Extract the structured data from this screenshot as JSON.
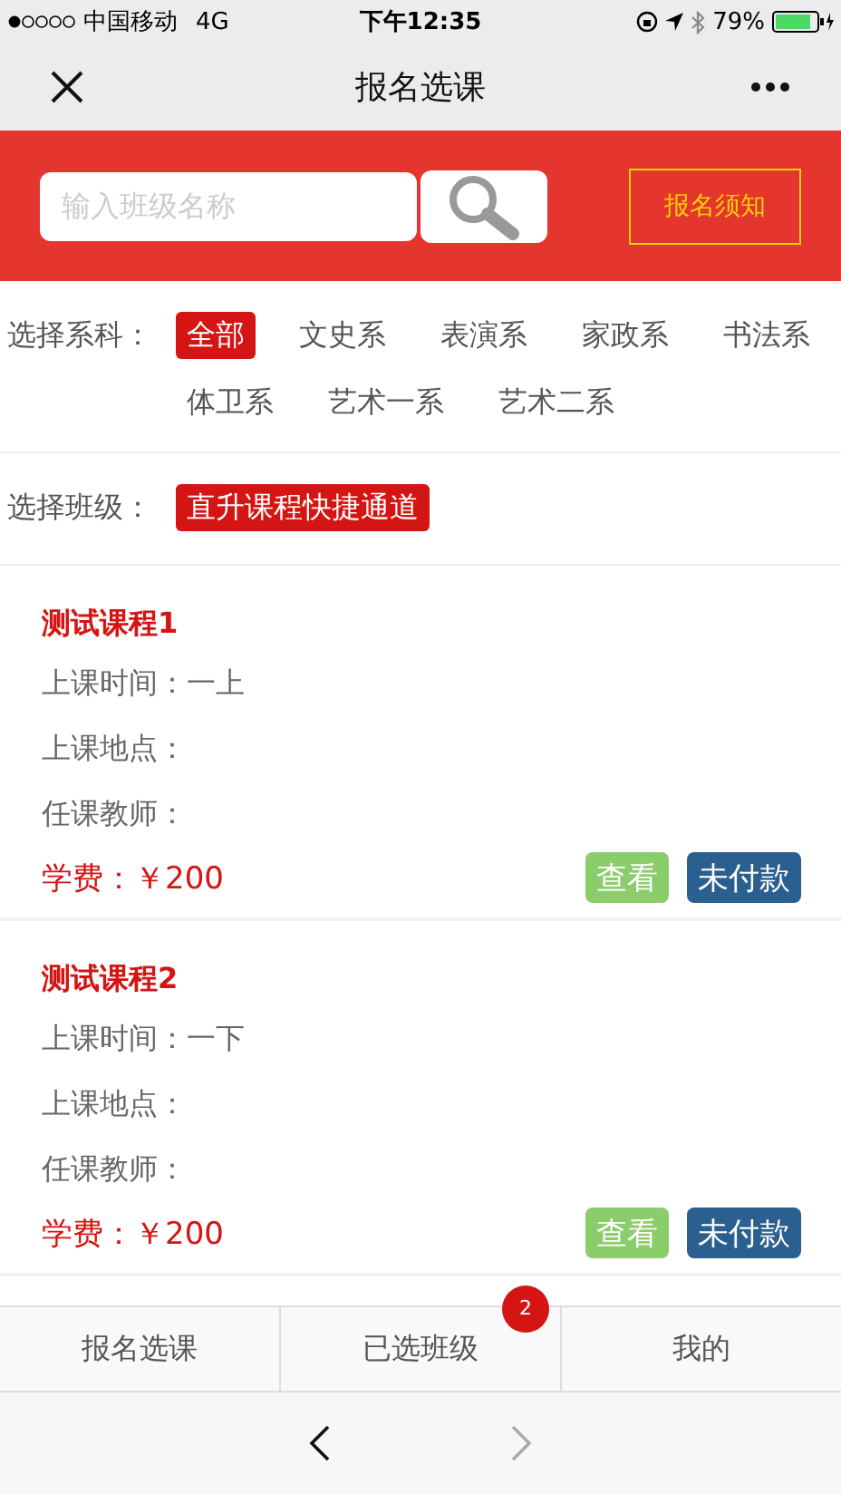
{
  "status_bar": {
    "carrier": "中国移动",
    "network": "4G",
    "time": "下午12:35",
    "battery": "79%"
  },
  "nav_bar": {
    "title": "报名选课"
  },
  "search": {
    "placeholder": "输入班级名称",
    "notice_button": "报名须知"
  },
  "department_filter": {
    "label": "选择系科：",
    "options": [
      {
        "label": "全部",
        "selected": true
      },
      {
        "label": "文史系",
        "selected": false
      },
      {
        "label": "表演系",
        "selected": false
      },
      {
        "label": "家政系",
        "selected": false
      },
      {
        "label": "书法系",
        "selected": false
      },
      {
        "label": "体卫系",
        "selected": false
      },
      {
        "label": "艺术一系",
        "selected": false
      },
      {
        "label": "艺术二系",
        "selected": false
      }
    ]
  },
  "class_filter": {
    "label": "选择班级：",
    "options": [
      {
        "label": "直升课程快捷通道",
        "selected": true
      }
    ]
  },
  "courses": [
    {
      "title": "测试课程1",
      "time": "上课时间：一上",
      "place": "上课地点：",
      "teacher": "任课教师：",
      "fee": "学费：￥200",
      "view_button": "查看",
      "pay_status": "未付款"
    },
    {
      "title": "测试课程2",
      "time": "上课时间：一下",
      "place": "上课地点：",
      "teacher": "任课教师：",
      "fee": "学费：￥200",
      "view_button": "查看",
      "pay_status": "未付款"
    }
  ],
  "tab_bar": [
    {
      "label": "报名选课"
    },
    {
      "label": "已选班级",
      "badge": "2"
    },
    {
      "label": "我的"
    }
  ],
  "browser_nav": {
    "back_enabled": true,
    "forward_enabled": false
  }
}
